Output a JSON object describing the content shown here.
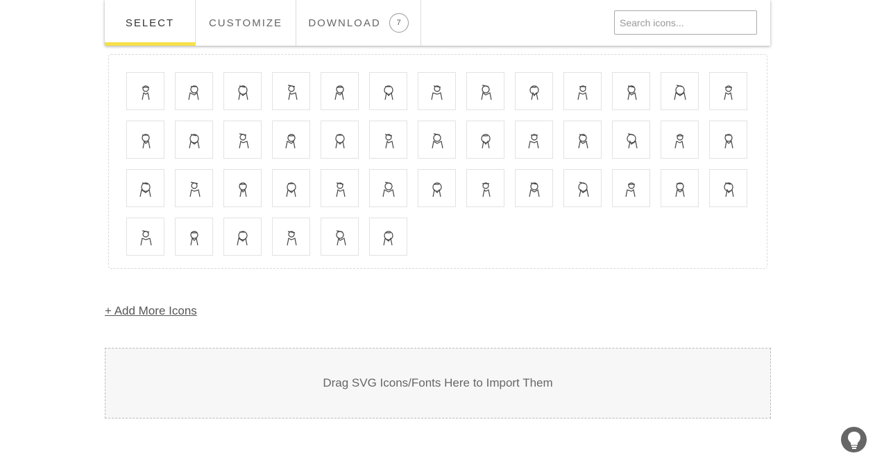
{
  "tabs": [
    {
      "label": "SELECT",
      "active": true
    },
    {
      "label": "CUSTOMIZE",
      "active": false
    },
    {
      "label": "DOWNLOAD",
      "active": false,
      "count": "7"
    }
  ],
  "search": {
    "placeholder": "Search icons..."
  },
  "icons": [
    "candles-icon",
    "ufo-icon",
    "nun-icon",
    "cauldron-fire-icon",
    "witch-pot-icon",
    "candle-icon",
    "spider-icon",
    "potion-bottle-icon",
    "voodoo-doll-icon",
    "gallows-icon",
    "zombie-face-icon",
    "shouting-man-icon",
    "lightning-hand-icon",
    "dog-face-icon",
    "finger-icon",
    "graveyard-icon",
    "native-chief-icon",
    "cow-icon",
    "guillotine-icon",
    "ghost-sheet-icon",
    "crossed-face-icon",
    "bomb-face-icon",
    "scythe-icon",
    "dagger-face-icon",
    "beetle-icon",
    "medusa-icon",
    "bong-icon",
    "mad-scientist-icon",
    "root-monster-icon",
    "hanging-figure-icon",
    "cauldron-icon",
    "earth-explosion-icon",
    "hook-man-icon",
    "pan-face-icon",
    "crying-face-icon",
    "fire-hand-icon",
    "poison-jar-icon",
    "steaming-pile-icon",
    "prison-bars-icon",
    "broken-tree-icon",
    "knight-icon",
    "skull-icon",
    "witch-on-broom-icon",
    "scarecrow-icon",
    "destroyed-city-icon"
  ],
  "add_more_label": "+ Add More Icons",
  "dropzone_label": "Drag SVG Icons/Fonts Here to Import Them",
  "colors": {
    "accent": "#f5e04a",
    "help_button": "#666666"
  }
}
